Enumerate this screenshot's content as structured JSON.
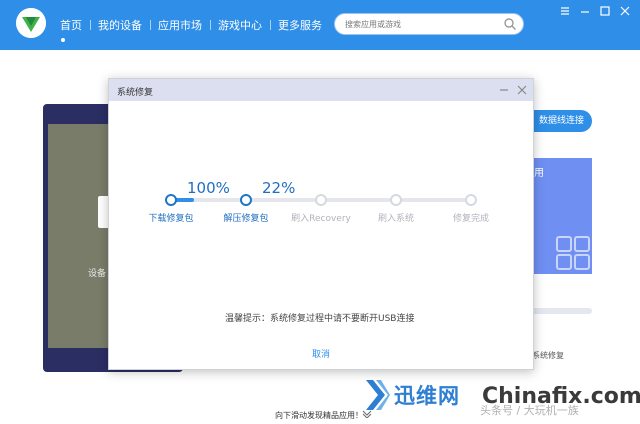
{
  "topbar": {
    "nav": [
      "首页",
      "我的设备",
      "应用市场",
      "游戏中心",
      "更多服务"
    ],
    "search_placeholder": "搜索应用或游戏"
  },
  "background": {
    "device_text": "设备",
    "right_button": "数据线连接",
    "right_panel_label": "用",
    "right_label": "系统修复",
    "bottom_text": "向下滑动发现精品应用！"
  },
  "modal": {
    "title": "系统修复",
    "steps": [
      {
        "label": "下载修复包",
        "percent": 100,
        "percent_text": "100%",
        "done": true
      },
      {
        "label": "解压修复包",
        "percent": 22,
        "percent_text": "22%",
        "done": true
      },
      {
        "label": "刷入Recovery",
        "done": false
      },
      {
        "label": "刷入系统",
        "done": false
      },
      {
        "label": "修复完成",
        "done": false
      }
    ],
    "tip": "温馨提示：系统修复过程中请不要断开USB连接",
    "cancel": "取消"
  },
  "watermark": {
    "brand": "迅维网",
    "site": "Chinafix.com",
    "tag": "头条号 / 大玩机一族"
  },
  "colors": {
    "accent": "#2f8ee8",
    "header_bar": "#dcdff0",
    "device": "#2a2e63",
    "panel": "#6f8ff2"
  }
}
